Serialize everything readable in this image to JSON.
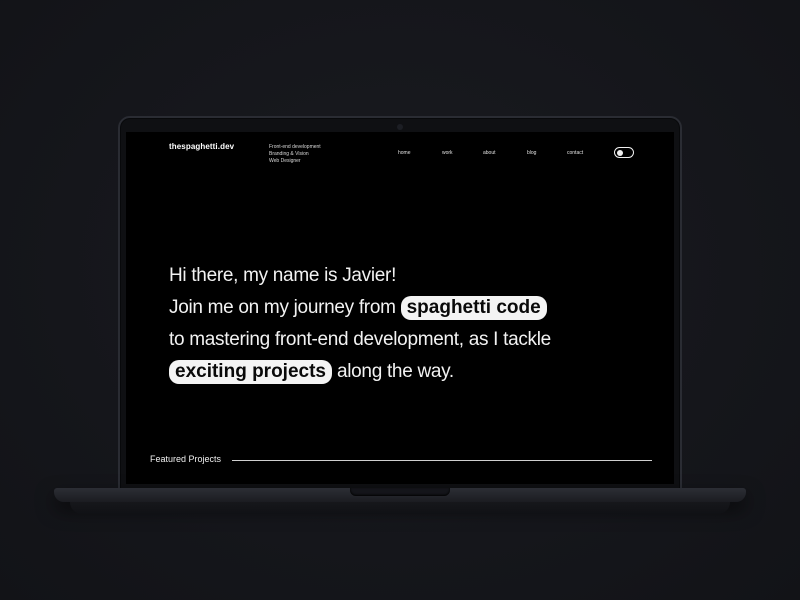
{
  "site": {
    "brand": "thespaghetti.dev",
    "tagline": [
      "Front-end development",
      "Branding & Vision",
      "Web Designer"
    ]
  },
  "nav": {
    "links": [
      "home",
      "work",
      "about",
      "blog",
      "contact"
    ],
    "theme_toggle_icon": "toggle-switch-icon"
  },
  "hero": {
    "line1": "Hi there, my name is Javier!",
    "line2_prefix": "Join me on my journey from ",
    "line2_highlight": "spaghetti code",
    "line3": "to mastering front-end development, as I tackle",
    "line4_highlight": "exciting projects",
    "line4_suffix": " along the way."
  },
  "featured": {
    "label": "Featured Projects"
  },
  "colors": {
    "background": "#15161b",
    "screen": "#000000",
    "text": "#f2f2f2",
    "pill_bg": "#f4f4f4",
    "pill_text": "#0a0a0a"
  }
}
